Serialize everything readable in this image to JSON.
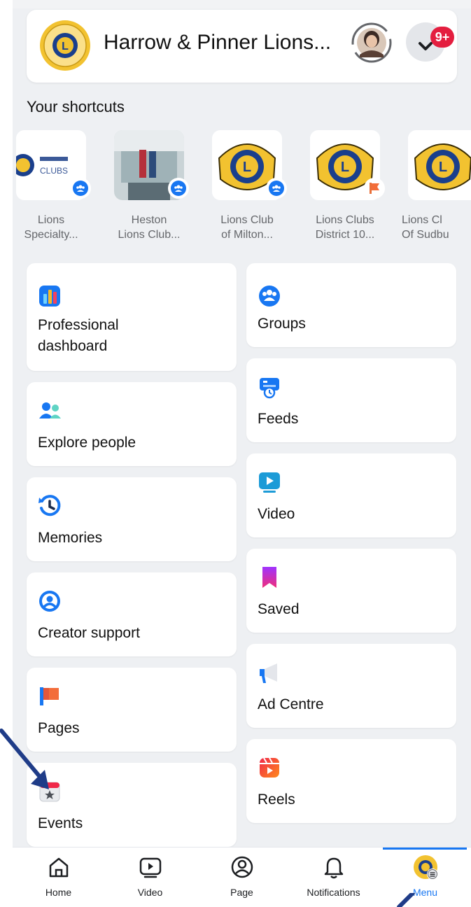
{
  "header": {
    "profile_name": "Harrow & Pinner Lions...",
    "notification_count": "9+"
  },
  "shortcuts": {
    "title": "Your shortcuts",
    "items": [
      {
        "label": "Lions\nSpecialty...",
        "badge": "group"
      },
      {
        "label": "Heston\nLions Club...",
        "badge": "group"
      },
      {
        "label": "Lions Club\nof Milton...",
        "badge": "group"
      },
      {
        "label": "Lions Clubs\nDistrict 10...",
        "badge": "page-flag"
      },
      {
        "label": "Lions Cl\nOf Sudbu",
        "badge": "none"
      }
    ]
  },
  "menu_left": [
    {
      "label": "Professional\ndashboard",
      "icon": "bar-chart-icon"
    },
    {
      "label": "Explore people",
      "icon": "people-icon"
    },
    {
      "label": "Memories",
      "icon": "clock-history-icon"
    },
    {
      "label": "Creator support",
      "icon": "person-circle-icon"
    },
    {
      "label": "Pages",
      "icon": "flag-icon"
    },
    {
      "label": "Events",
      "icon": "calendar-star-icon"
    }
  ],
  "menu_right": [
    {
      "label": "Groups",
      "icon": "groups-icon"
    },
    {
      "label": "Feeds",
      "icon": "feeds-icon"
    },
    {
      "label": "Video",
      "icon": "play-icon"
    },
    {
      "label": "Saved",
      "icon": "bookmark-icon"
    },
    {
      "label": "Ad Centre",
      "icon": "megaphone-icon"
    },
    {
      "label": "Reels",
      "icon": "reels-icon"
    }
  ],
  "bottom_nav": [
    {
      "label": "Home",
      "icon": "home-icon"
    },
    {
      "label": "Video",
      "icon": "video-icon"
    },
    {
      "label": "Page",
      "icon": "page-profile-icon"
    },
    {
      "label": "Notifications",
      "icon": "bell-icon"
    },
    {
      "label": "Menu",
      "icon": "menu-avatar-icon",
      "active": true
    }
  ],
  "colors": {
    "accent": "#1877f2",
    "background": "#eef0f3",
    "badge": "#e41e3f",
    "annotation_arrow": "#1f3c88"
  }
}
